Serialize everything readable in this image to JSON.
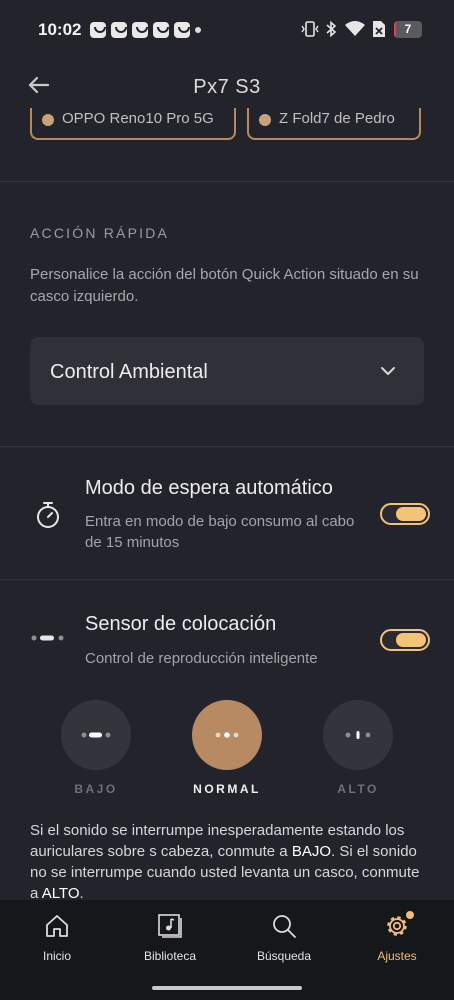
{
  "status_bar": {
    "time": "10:02",
    "battery_level": "7",
    "battery_fraction": 0.07,
    "icons": [
      "notification-app-icon",
      "vibrate-icon",
      "bluetooth-icon",
      "wifi-icon",
      "no-sim-icon",
      "battery-icon"
    ]
  },
  "header": {
    "title": "Px7 S3",
    "back_icon": "arrow-left-icon"
  },
  "clipped_chips": {
    "left": "OPPO Reno10 Pro 5G",
    "right": "Z Fold7 de Pedro"
  },
  "quick_action": {
    "title": "ACCIÓN RÁPIDA",
    "description": "Personalice la acción del botón Quick Action situado en su casco izquierdo.",
    "selected": "Control Ambiental"
  },
  "auto_standby": {
    "title": "Modo de espera automático",
    "subtitle": "Entra en modo de bajo consumo al cabo de 15 minutos",
    "enabled": true,
    "icon": "stopwatch-icon"
  },
  "wear_sensor": {
    "title": "Sensor de colocación",
    "subtitle": "Control de reproducción inteligente",
    "enabled": true,
    "icon": "sensor-dots-icon",
    "levels": [
      {
        "label": "BAJO",
        "active": false
      },
      {
        "label": "NORMAL",
        "active": true
      },
      {
        "label": "ALTO",
        "active": false
      }
    ]
  },
  "info": {
    "part1": "Si el sonido se interrumpe inesperadamente estando los auriculares sobre s cabeza, conmute a ",
    "low": "BAJO",
    "part2": ". Si el sonido no se interrumpe cuando usted levanta un casco, conmute a ",
    "high": "ALTO",
    "part3": "."
  },
  "bottom_nav": {
    "items": [
      {
        "label": "Inicio",
        "icon": "home-icon"
      },
      {
        "label": "Biblioteca",
        "icon": "music-library-icon"
      },
      {
        "label": "Búsqueda",
        "icon": "search-icon"
      },
      {
        "label": "Ajustes",
        "icon": "gear-icon"
      }
    ],
    "active": "Ajustes"
  },
  "colors": {
    "accent": "#f0be78",
    "background": "#23242b",
    "nav_background": "#16171b",
    "selected_level": "#b88a64"
  }
}
